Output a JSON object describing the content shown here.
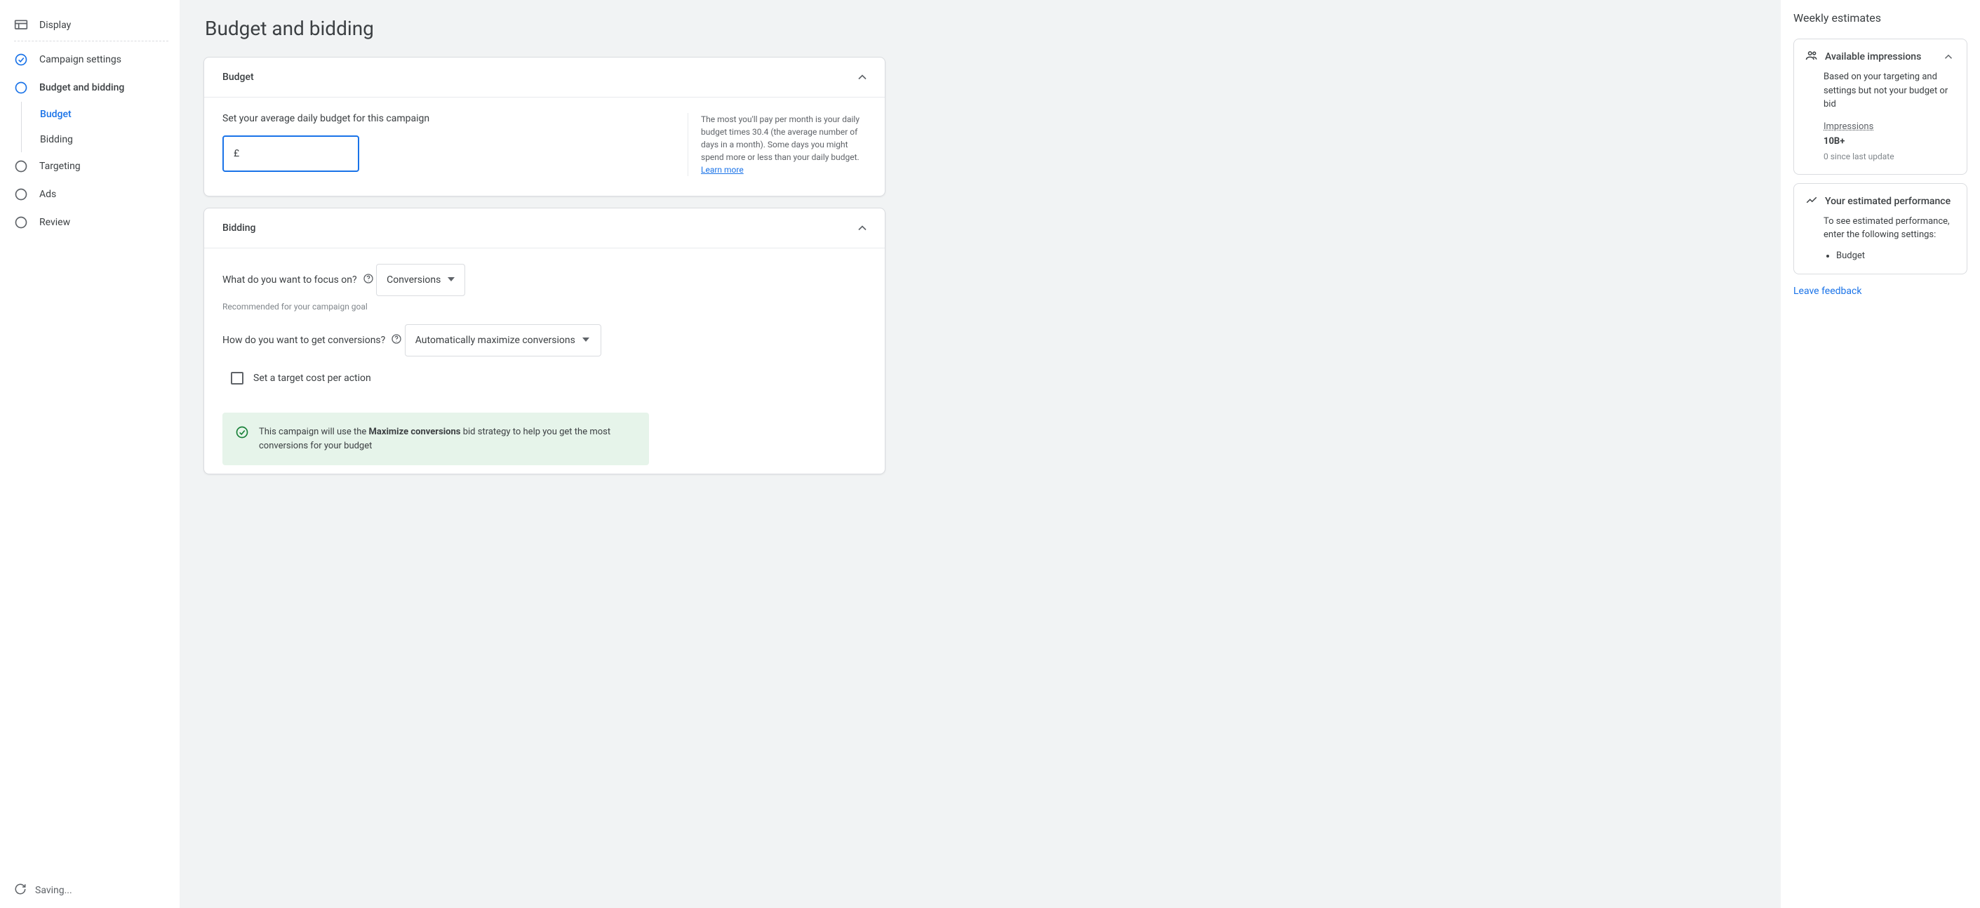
{
  "sidebar": {
    "type": "Display",
    "items": [
      {
        "label": "Campaign settings",
        "state": "done"
      },
      {
        "label": "Budget and bidding",
        "state": "current"
      },
      {
        "label": "Targeting",
        "state": "todo"
      },
      {
        "label": "Ads",
        "state": "todo"
      },
      {
        "label": "Review",
        "state": "todo"
      }
    ],
    "sub": {
      "budget": "Budget",
      "bidding": "Bidding"
    },
    "saving": "Saving..."
  },
  "page": {
    "title": "Budget and bidding"
  },
  "budget_card": {
    "header": "Budget",
    "label": "Set your average daily budget for this campaign",
    "currency": "£",
    "value": "",
    "info_text": "The most you'll pay per month is your daily budget times 30.4 (the average number of days in a month). Some days you might spend more or less than your daily budget. ",
    "learn_more": "Learn more"
  },
  "bidding_card": {
    "header": "Bidding",
    "focus_label": "What do you want to focus on?",
    "focus_value": "Conversions",
    "focus_helper": "Recommended for your campaign goal",
    "how_label": "How do you want to get conversions?",
    "how_value": "Automatically maximize conversions",
    "target_cpa_label": "Set a target cost per action",
    "banner_pre": "This campaign will use the ",
    "banner_bold": "Maximize conversions",
    "banner_post": " bid strategy to help you get the most conversions for your budget"
  },
  "right": {
    "title": "Weekly estimates",
    "impressions_card": {
      "header": "Available impressions",
      "desc": "Based on your targeting and settings but not your budget or bid",
      "metric_label": "Impressions",
      "metric_value": "10B+",
      "metric_sub": "0 since last update"
    },
    "perf_card": {
      "header": "Your estimated performance",
      "desc": "To see estimated performance, enter the following settings:",
      "missing": [
        "Budget"
      ]
    },
    "feedback": "Leave feedback"
  }
}
